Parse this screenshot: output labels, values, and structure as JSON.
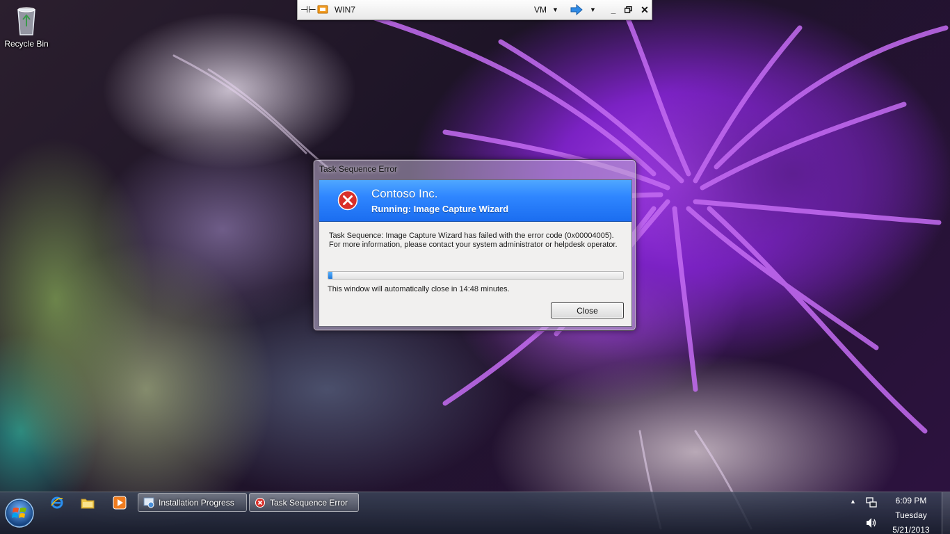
{
  "desktop": {
    "icons": [
      {
        "label": "Recycle Bin",
        "icon": "recycle-bin-icon"
      }
    ]
  },
  "vm_bar": {
    "title": "WIN7",
    "menu_label": "VM",
    "icons": [
      "pin-icon",
      "monitor-icon",
      "chevron-down-icon",
      "arrow-right-icon",
      "minimize-icon",
      "restore-icon",
      "close-icon"
    ]
  },
  "dialog": {
    "title": "Task Sequence Error",
    "organization": "Contoso Inc.",
    "running_text": "Running: Image Capture Wizard",
    "message_line1": "Task Sequence: Image Capture Wizard has failed with the error code  (0x00004005).",
    "message_line2": "For more information, please contact your system administrator or helpdesk operator.",
    "progress_percent": 1.5,
    "countdown_text": "This window will automatically close in 14:48 minutes.",
    "close_label": "Close",
    "icon": "error-icon"
  },
  "taskbar": {
    "pinned": [
      "internet-explorer-icon",
      "windows-explorer-icon",
      "media-player-icon"
    ],
    "tasks": [
      {
        "label": "Installation Progress",
        "icon": "installation-icon"
      },
      {
        "label": "Task Sequence Error",
        "icon": "error-icon"
      }
    ],
    "clock": {
      "time": "6:09 PM",
      "day": "Tuesday",
      "date": "5/21/2013"
    }
  },
  "colors": {
    "banner_blue": "#2f86ff",
    "error_red": "#d9302a",
    "progress_blue": "#1f78d8"
  }
}
